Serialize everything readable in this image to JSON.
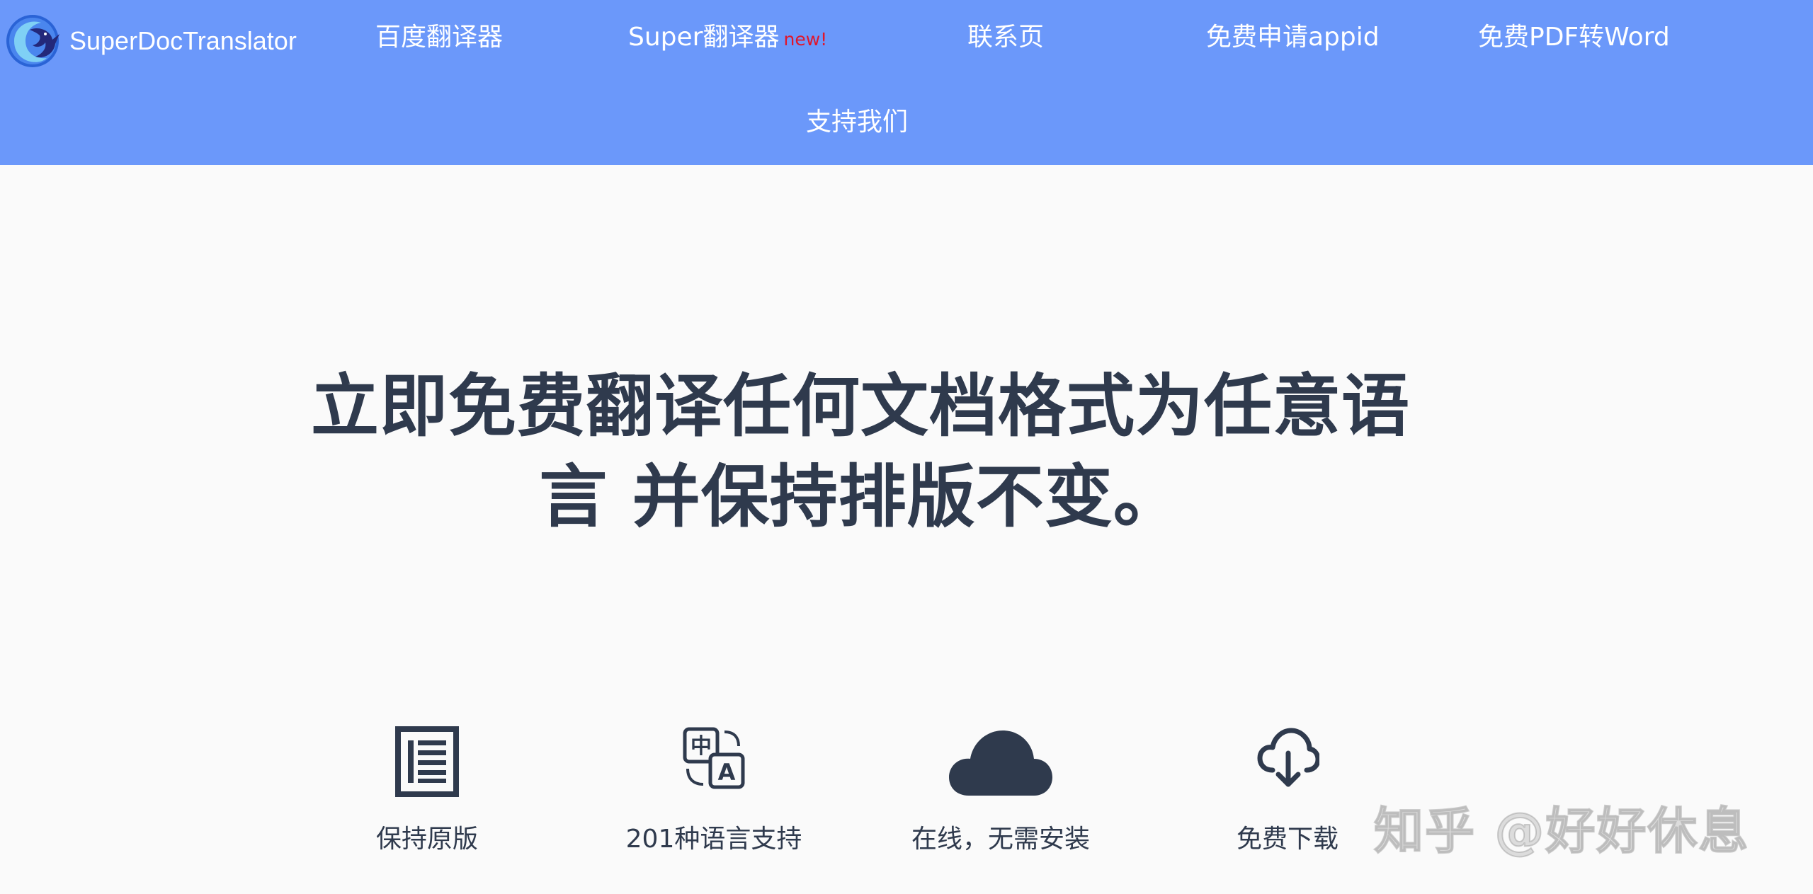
{
  "nav": {
    "brand": "SuperDocTranslator",
    "links": [
      {
        "label": "百度翻译器"
      },
      {
        "label": "Super翻译器",
        "badge": "new!"
      },
      {
        "label": "联系页"
      },
      {
        "label": "免费申请appid"
      },
      {
        "label": "免费PDF转Word"
      },
      {
        "label": "支持我们"
      }
    ]
  },
  "hero": {
    "title": "立即免费翻译任何文档格式为任意语言 并保持排版不变。"
  },
  "features": [
    {
      "label": "保持原版",
      "icon": "document-layout-icon"
    },
    {
      "label": "201种语言支持",
      "icon": "language-translate-icon"
    },
    {
      "label": "在线，无需安装",
      "icon": "cloud-icon"
    },
    {
      "label": "免费下载",
      "icon": "cloud-download-icon"
    }
  ],
  "watermark": "知乎 @好好休息",
  "colors": {
    "nav_bg": "#6b98fa",
    "text_dark": "#2f3a4d",
    "badge_red": "#e0162b",
    "page_bg": "#fafafa"
  }
}
